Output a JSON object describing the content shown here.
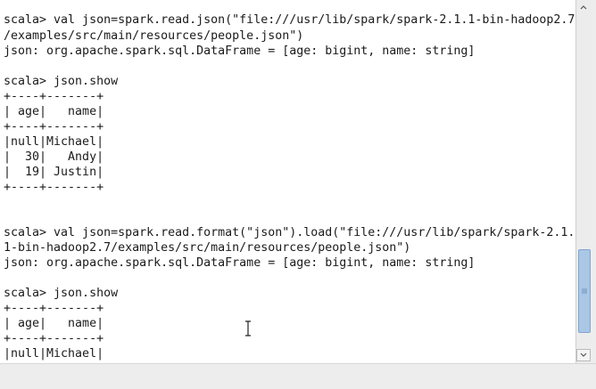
{
  "terminal": {
    "lines": [
      "scala> val json=spark.read.json(\"file:///usr/lib/spark/spark-2.1.1-bin-hadoop2.7",
      "/examples/src/main/resources/people.json\")",
      "json: org.apache.spark.sql.DataFrame = [age: bigint, name: string]",
      "",
      "scala> json.show",
      "+----+-------+",
      "| age|   name|",
      "+----+-------+",
      "|null|Michael|",
      "|  30|   Andy|",
      "|  19| Justin|",
      "+----+-------+",
      "",
      "",
      "scala> val json=spark.read.format(\"json\").load(\"file:///usr/lib/spark/spark-2.1.",
      "1-bin-hadoop2.7/examples/src/main/resources/people.json\")",
      "json: org.apache.spark.sql.DataFrame = [age: bigint, name: string]",
      "",
      "scala> json.show",
      "+----+-------+",
      "| age|   name|",
      "+----+-------+",
      "|null|Michael|"
    ]
  },
  "icons": {
    "cursor": "ibeam-cursor-icon",
    "scroll_up": "scroll-up-arrow-icon",
    "scroll_down": "scroll-down-arrow-icon",
    "thumb_grip": "grip-icon"
  },
  "colors": {
    "text": "#1a1a1a",
    "background": "#ffffff",
    "thumb": "#aac7e6"
  }
}
